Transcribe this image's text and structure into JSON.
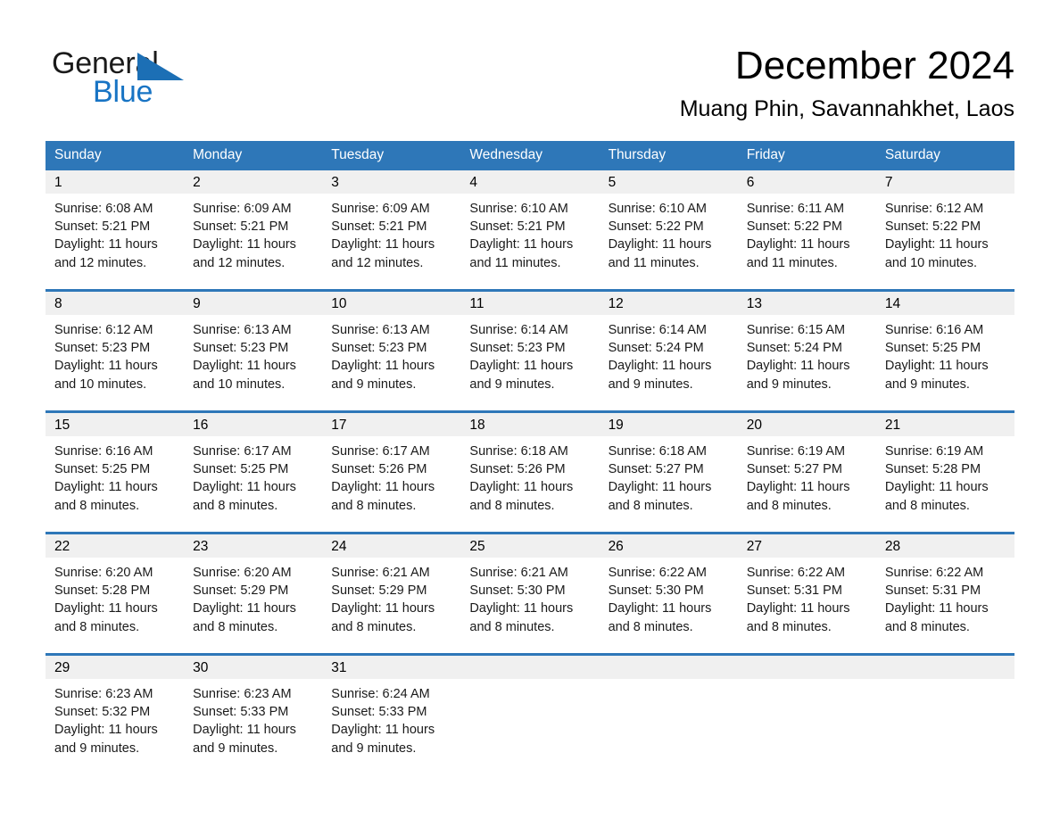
{
  "brand": {
    "name_part1": "General",
    "name_part2": "Blue",
    "accent_color": "#1874c4",
    "triangle_color": "#1c6fb5"
  },
  "header": {
    "month_title": "December 2024",
    "location": "Muang Phin, Savannahkhet, Laos",
    "header_bg": "#2e77b8"
  },
  "weekday_headers": [
    "Sunday",
    "Monday",
    "Tuesday",
    "Wednesday",
    "Thursday",
    "Friday",
    "Saturday"
  ],
  "weeks": [
    {
      "days": [
        {
          "num": "1",
          "sunrise": "Sunrise: 6:08 AM",
          "sunset": "Sunset: 5:21 PM",
          "daylight_line1": "Daylight: 11 hours",
          "daylight_line2": "and 12 minutes."
        },
        {
          "num": "2",
          "sunrise": "Sunrise: 6:09 AM",
          "sunset": "Sunset: 5:21 PM",
          "daylight_line1": "Daylight: 11 hours",
          "daylight_line2": "and 12 minutes."
        },
        {
          "num": "3",
          "sunrise": "Sunrise: 6:09 AM",
          "sunset": "Sunset: 5:21 PM",
          "daylight_line1": "Daylight: 11 hours",
          "daylight_line2": "and 12 minutes."
        },
        {
          "num": "4",
          "sunrise": "Sunrise: 6:10 AM",
          "sunset": "Sunset: 5:21 PM",
          "daylight_line1": "Daylight: 11 hours",
          "daylight_line2": "and 11 minutes."
        },
        {
          "num": "5",
          "sunrise": "Sunrise: 6:10 AM",
          "sunset": "Sunset: 5:22 PM",
          "daylight_line1": "Daylight: 11 hours",
          "daylight_line2": "and 11 minutes."
        },
        {
          "num": "6",
          "sunrise": "Sunrise: 6:11 AM",
          "sunset": "Sunset: 5:22 PM",
          "daylight_line1": "Daylight: 11 hours",
          "daylight_line2": "and 11 minutes."
        },
        {
          "num": "7",
          "sunrise": "Sunrise: 6:12 AM",
          "sunset": "Sunset: 5:22 PM",
          "daylight_line1": "Daylight: 11 hours",
          "daylight_line2": "and 10 minutes."
        }
      ]
    },
    {
      "days": [
        {
          "num": "8",
          "sunrise": "Sunrise: 6:12 AM",
          "sunset": "Sunset: 5:23 PM",
          "daylight_line1": "Daylight: 11 hours",
          "daylight_line2": "and 10 minutes."
        },
        {
          "num": "9",
          "sunrise": "Sunrise: 6:13 AM",
          "sunset": "Sunset: 5:23 PM",
          "daylight_line1": "Daylight: 11 hours",
          "daylight_line2": "and 10 minutes."
        },
        {
          "num": "10",
          "sunrise": "Sunrise: 6:13 AM",
          "sunset": "Sunset: 5:23 PM",
          "daylight_line1": "Daylight: 11 hours",
          "daylight_line2": "and 9 minutes."
        },
        {
          "num": "11",
          "sunrise": "Sunrise: 6:14 AM",
          "sunset": "Sunset: 5:23 PM",
          "daylight_line1": "Daylight: 11 hours",
          "daylight_line2": "and 9 minutes."
        },
        {
          "num": "12",
          "sunrise": "Sunrise: 6:14 AM",
          "sunset": "Sunset: 5:24 PM",
          "daylight_line1": "Daylight: 11 hours",
          "daylight_line2": "and 9 minutes."
        },
        {
          "num": "13",
          "sunrise": "Sunrise: 6:15 AM",
          "sunset": "Sunset: 5:24 PM",
          "daylight_line1": "Daylight: 11 hours",
          "daylight_line2": "and 9 minutes."
        },
        {
          "num": "14",
          "sunrise": "Sunrise: 6:16 AM",
          "sunset": "Sunset: 5:25 PM",
          "daylight_line1": "Daylight: 11 hours",
          "daylight_line2": "and 9 minutes."
        }
      ]
    },
    {
      "days": [
        {
          "num": "15",
          "sunrise": "Sunrise: 6:16 AM",
          "sunset": "Sunset: 5:25 PM",
          "daylight_line1": "Daylight: 11 hours",
          "daylight_line2": "and 8 minutes."
        },
        {
          "num": "16",
          "sunrise": "Sunrise: 6:17 AM",
          "sunset": "Sunset: 5:25 PM",
          "daylight_line1": "Daylight: 11 hours",
          "daylight_line2": "and 8 minutes."
        },
        {
          "num": "17",
          "sunrise": "Sunrise: 6:17 AM",
          "sunset": "Sunset: 5:26 PM",
          "daylight_line1": "Daylight: 11 hours",
          "daylight_line2": "and 8 minutes."
        },
        {
          "num": "18",
          "sunrise": "Sunrise: 6:18 AM",
          "sunset": "Sunset: 5:26 PM",
          "daylight_line1": "Daylight: 11 hours",
          "daylight_line2": "and 8 minutes."
        },
        {
          "num": "19",
          "sunrise": "Sunrise: 6:18 AM",
          "sunset": "Sunset: 5:27 PM",
          "daylight_line1": "Daylight: 11 hours",
          "daylight_line2": "and 8 minutes."
        },
        {
          "num": "20",
          "sunrise": "Sunrise: 6:19 AM",
          "sunset": "Sunset: 5:27 PM",
          "daylight_line1": "Daylight: 11 hours",
          "daylight_line2": "and 8 minutes."
        },
        {
          "num": "21",
          "sunrise": "Sunrise: 6:19 AM",
          "sunset": "Sunset: 5:28 PM",
          "daylight_line1": "Daylight: 11 hours",
          "daylight_line2": "and 8 minutes."
        }
      ]
    },
    {
      "days": [
        {
          "num": "22",
          "sunrise": "Sunrise: 6:20 AM",
          "sunset": "Sunset: 5:28 PM",
          "daylight_line1": "Daylight: 11 hours",
          "daylight_line2": "and 8 minutes."
        },
        {
          "num": "23",
          "sunrise": "Sunrise: 6:20 AM",
          "sunset": "Sunset: 5:29 PM",
          "daylight_line1": "Daylight: 11 hours",
          "daylight_line2": "and 8 minutes."
        },
        {
          "num": "24",
          "sunrise": "Sunrise: 6:21 AM",
          "sunset": "Sunset: 5:29 PM",
          "daylight_line1": "Daylight: 11 hours",
          "daylight_line2": "and 8 minutes."
        },
        {
          "num": "25",
          "sunrise": "Sunrise: 6:21 AM",
          "sunset": "Sunset: 5:30 PM",
          "daylight_line1": "Daylight: 11 hours",
          "daylight_line2": "and 8 minutes."
        },
        {
          "num": "26",
          "sunrise": "Sunrise: 6:22 AM",
          "sunset": "Sunset: 5:30 PM",
          "daylight_line1": "Daylight: 11 hours",
          "daylight_line2": "and 8 minutes."
        },
        {
          "num": "27",
          "sunrise": "Sunrise: 6:22 AM",
          "sunset": "Sunset: 5:31 PM",
          "daylight_line1": "Daylight: 11 hours",
          "daylight_line2": "and 8 minutes."
        },
        {
          "num": "28",
          "sunrise": "Sunrise: 6:22 AM",
          "sunset": "Sunset: 5:31 PM",
          "daylight_line1": "Daylight: 11 hours",
          "daylight_line2": "and 8 minutes."
        }
      ]
    },
    {
      "days": [
        {
          "num": "29",
          "sunrise": "Sunrise: 6:23 AM",
          "sunset": "Sunset: 5:32 PM",
          "daylight_line1": "Daylight: 11 hours",
          "daylight_line2": "and 9 minutes."
        },
        {
          "num": "30",
          "sunrise": "Sunrise: 6:23 AM",
          "sunset": "Sunset: 5:33 PM",
          "daylight_line1": "Daylight: 11 hours",
          "daylight_line2": "and 9 minutes."
        },
        {
          "num": "31",
          "sunrise": "Sunrise: 6:24 AM",
          "sunset": "Sunset: 5:33 PM",
          "daylight_line1": "Daylight: 11 hours",
          "daylight_line2": "and 9 minutes."
        },
        {
          "num": "",
          "sunrise": "",
          "sunset": "",
          "daylight_line1": "",
          "daylight_line2": ""
        },
        {
          "num": "",
          "sunrise": "",
          "sunset": "",
          "daylight_line1": "",
          "daylight_line2": ""
        },
        {
          "num": "",
          "sunrise": "",
          "sunset": "",
          "daylight_line1": "",
          "daylight_line2": ""
        },
        {
          "num": "",
          "sunrise": "",
          "sunset": "",
          "daylight_line1": "",
          "daylight_line2": ""
        }
      ]
    }
  ]
}
